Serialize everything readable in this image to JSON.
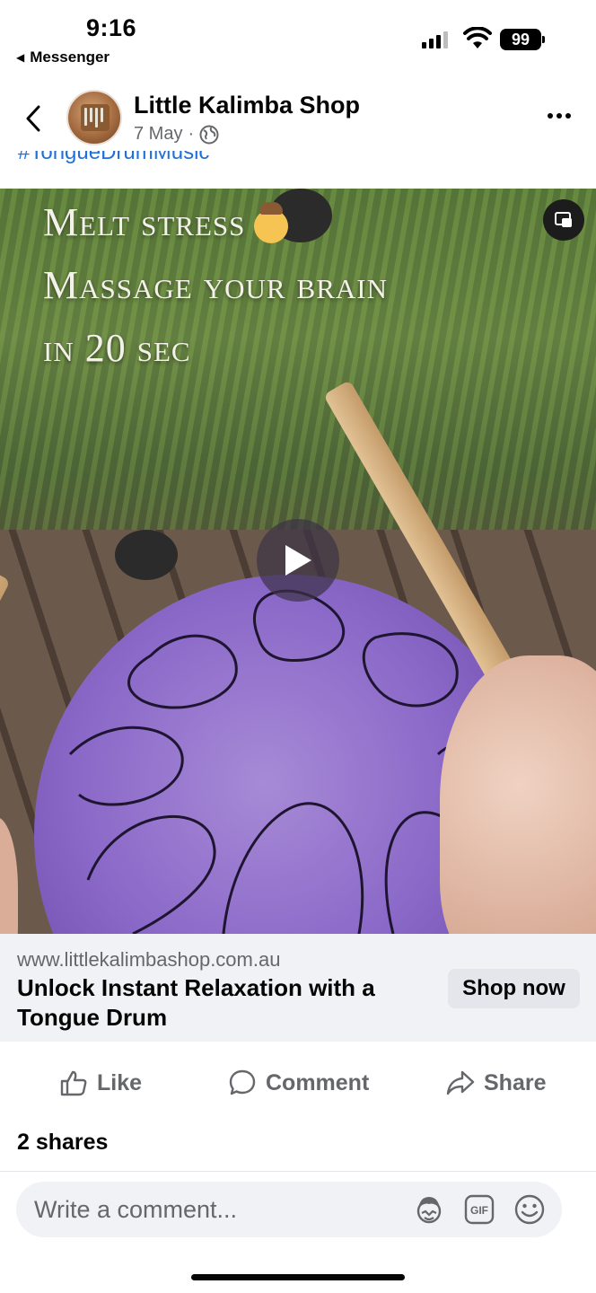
{
  "status_bar": {
    "time": "9:16",
    "back_app": "Messenger",
    "battery": "99"
  },
  "post": {
    "page_name": "Little Kalimba Shop",
    "date": "7 May",
    "separator": "·",
    "hashtag": "#TongueDrumMusic"
  },
  "video": {
    "overlay_line1": "Melt stress",
    "overlay_line2": "Massage your brain",
    "overlay_line3": "in 20 sec",
    "emoji": "face-massage-emoji"
  },
  "link_card": {
    "url": "www.littlekalimbashop.com.au",
    "title": "Unlock Instant Relaxation with a Tongue Drum",
    "cta": "Shop now"
  },
  "actions": {
    "like": "Like",
    "comment": "Comment",
    "share": "Share"
  },
  "shares": "2 shares",
  "comment_box": {
    "placeholder": "Write a comment..."
  },
  "colors": {
    "link": "#216fdb",
    "secondary_text": "#65676b",
    "drum": "#8a68c8"
  }
}
